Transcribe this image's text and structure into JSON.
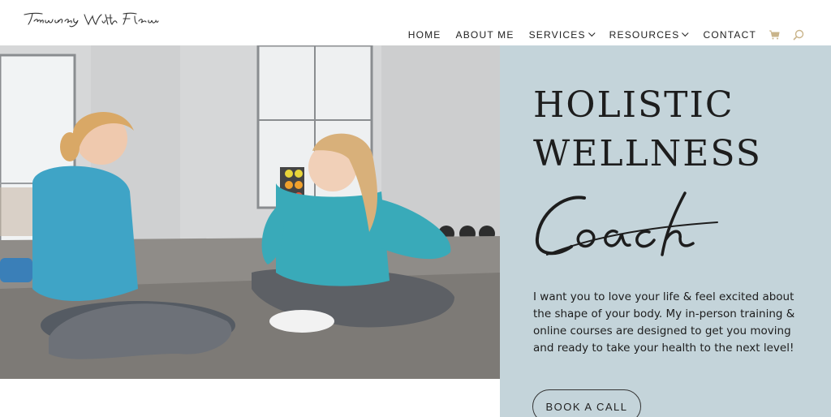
{
  "header": {
    "logo_text": "Training With Floriane",
    "nav": [
      {
        "label": "HOME"
      },
      {
        "label": "ABOUT ME"
      },
      {
        "label": "SERVICES"
      },
      {
        "label": "RESOURCES"
      },
      {
        "label": "CONTACT"
      }
    ],
    "cart_icon": "cart-icon",
    "search_icon": "search-icon"
  },
  "hero": {
    "photo_alt": "Two women sitting on a gym floor, talking",
    "heading_line1": "HOLISTIC",
    "heading_line2": "WELLNESS",
    "script_word": "Coach",
    "blurb": "I want you to love your life & feel excited about the shape of your body. My in-person training & online courses are designed to get you moving and ready to take your health to the next level!",
    "cta_label": "BOOK A CALL",
    "panel_color": "#c4d4da"
  }
}
